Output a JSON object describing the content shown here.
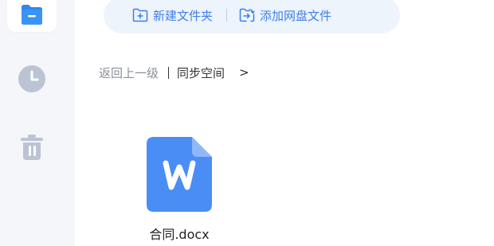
{
  "sidebar": {
    "items": [
      {
        "icon": "folder-icon"
      },
      {
        "icon": "clock-icon"
      },
      {
        "icon": "trash-icon"
      }
    ]
  },
  "toolbar": {
    "new_folder_label": "新建文件夹",
    "add_file_label": "添加网盘文件"
  },
  "breadcrumb": {
    "back_label": "返回上一级",
    "current": "同步空间",
    "arrow": ">"
  },
  "files": [
    {
      "name": "合同.docx",
      "type": "word-doc-icon"
    }
  ],
  "colors": {
    "accent": "#3f7fe8",
    "file_icon": "#4a8df5",
    "sidebar_bg": "#f4f6f9",
    "toolbar_bg": "#edf4fc"
  }
}
